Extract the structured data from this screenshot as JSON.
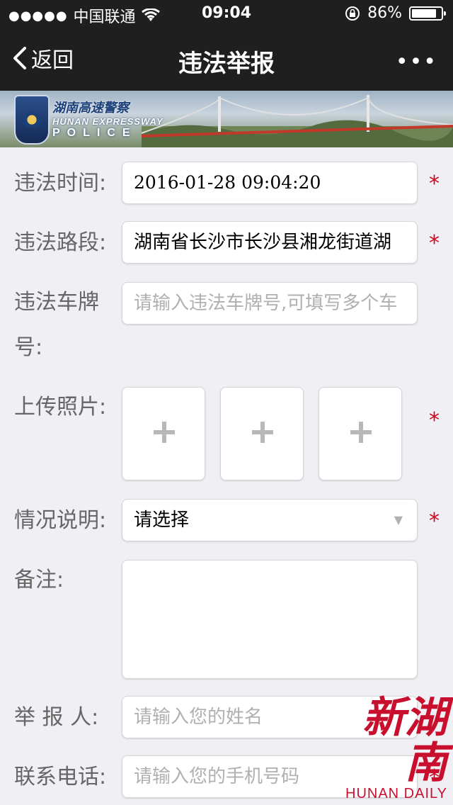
{
  "status_bar": {
    "carrier": "中国联通",
    "time": "09:04",
    "battery": "86%",
    "battery_level": 0.86
  },
  "nav": {
    "back_label": "返回",
    "title": "违法举报",
    "more_label": "•••"
  },
  "banner": {
    "title_cn": "湖南高速警察",
    "title_en": "HUNAN EXPRESSWAY",
    "police": "POLICE"
  },
  "form": {
    "time_label": "违法时间:",
    "time_value": "2016-01-28 09:04:20",
    "road_label": "违法路段:",
    "road_value": "湖南省长沙市长沙县湘龙街道湖",
    "plate_label_line1": "违法车牌",
    "plate_label_line2": "号:",
    "plate_placeholder": "请输入违法车牌号,可填写多个车",
    "photo_label": "上传照片:",
    "desc_label": "情况说明:",
    "desc_value": "请选择",
    "notes_label": "备注:",
    "reporter_label": "举 报 人:",
    "reporter_placeholder": "请输入您的姓名",
    "phone_label": "联系电话:",
    "phone_placeholder": "请输入您的手机号码",
    "required_mark": "*"
  },
  "watermark": {
    "cn": "新湖南",
    "en": "HUNAN DAILY"
  },
  "colors": {
    "required": "#d0021b",
    "bar": "#1f1f1f",
    "background": "#efeff4",
    "watermark": "#c8102e"
  }
}
